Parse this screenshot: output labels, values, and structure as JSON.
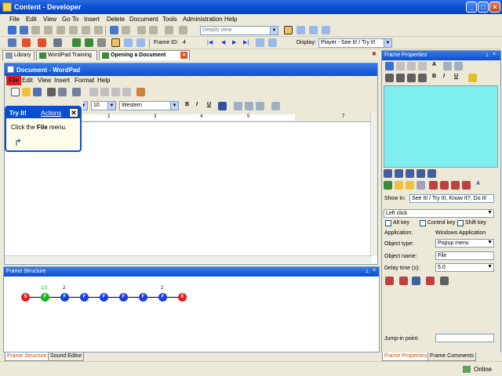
{
  "app": {
    "title": "Content - Developer"
  },
  "menu": [
    "File",
    "Edit",
    "View",
    "Go To",
    "Insert",
    "Delete",
    "Document",
    "Tools",
    "Administration",
    "Help"
  ],
  "toolbar": {
    "view_combo": "Details view",
    "frame_id_label": "Frame ID:",
    "frame_id_value": "4",
    "display_label": "Display:",
    "display_value": "Player - See It! / Try It!"
  },
  "tabs": [
    {
      "label": "Library"
    },
    {
      "label": "WordPad Training"
    },
    {
      "label": "Opening a Document"
    }
  ],
  "wordpad": {
    "title": "Document - WordPad",
    "menu": [
      "File",
      "Edit",
      "View",
      "Insert",
      "Format",
      "Help"
    ],
    "font_size": "10",
    "script": "Western",
    "ruler": [
      "1",
      "2",
      "3",
      "4",
      "5",
      "6",
      "7"
    ]
  },
  "tryit": {
    "title": "Try It!",
    "actions": "Actions",
    "text_pre": "Click the ",
    "text_bold": "File",
    "text_post": " menu."
  },
  "frame_structure": {
    "title": "Frame Structure",
    "nodes": [
      {
        "label": "S",
        "color": "#e0201c"
      },
      {
        "label": "F",
        "color": "#18b818",
        "badge": "1/2"
      },
      {
        "label": "F",
        "color": "#1a3fe0",
        "badge": "2"
      },
      {
        "label": "F",
        "color": "#1a3fe0"
      },
      {
        "label": "F",
        "color": "#1a3fe0"
      },
      {
        "label": "F",
        "color": "#1a3fe0"
      },
      {
        "label": "F",
        "color": "#1a3fe0"
      },
      {
        "label": "F",
        "color": "#1a3fe0",
        "badge": "2"
      },
      {
        "label": "E",
        "color": "#e0201c"
      }
    ],
    "tab_active": "Frame Structure",
    "tab_other": "Sound Editor"
  },
  "frame_properties": {
    "title": "Frame Properties",
    "show_in_label": "Show in:",
    "show_in_value": "See It! / Try It!, Know It?, Do It!",
    "action_value": "Left click",
    "alt": "Alt key",
    "ctrl": "Control key",
    "shift": "Shift key",
    "application_label": "Application:",
    "application_value": "Windows Application",
    "object_type_label": "Object type:",
    "object_type_value": "Popup menu",
    "object_name_label": "Object name:",
    "object_name_value": "File",
    "delay_label": "Delay time (s):",
    "delay_value": "5.0",
    "jump_label": "Jump-in point:",
    "tab_active": "Frame Properties",
    "tab_other": "Frame Comments"
  },
  "status": {
    "online": "Online"
  }
}
